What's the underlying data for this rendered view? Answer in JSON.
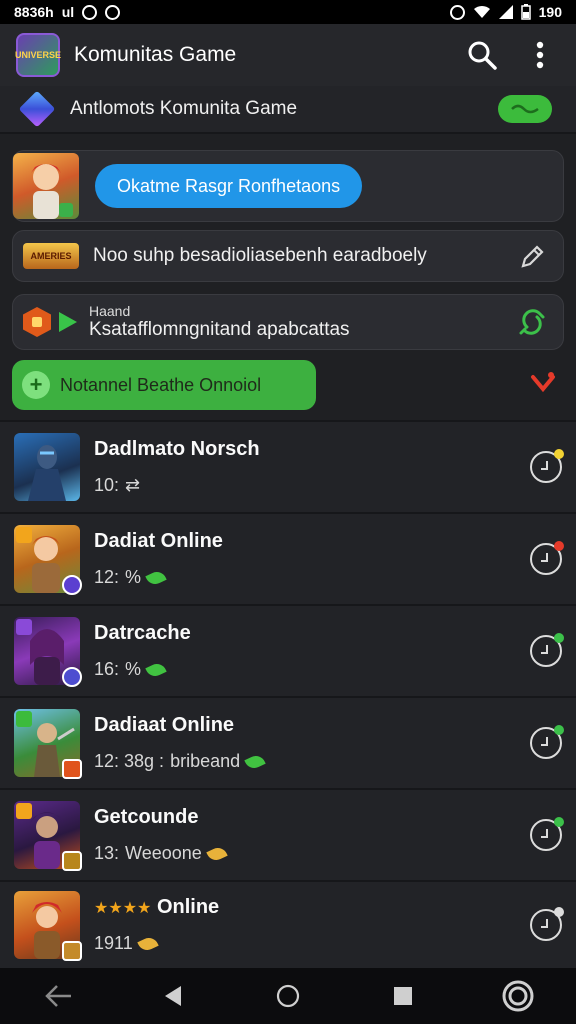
{
  "status_bar": {
    "left_text": "8836h",
    "left_extra": "ul",
    "right_text": "190"
  },
  "app_bar": {
    "title": "Komunitas Game",
    "logo_text": "UNIVERSE"
  },
  "community": {
    "label": "Antlomots Komunita Game",
    "bubble_text": ""
  },
  "cards": {
    "card1": {
      "button_label": "Okatme Rasgr Ronfhetaons"
    },
    "card2": {
      "badge_text": "AMERIES",
      "text": "Noo suhp besadioliasebenh earadboely"
    },
    "card3": {
      "small_text": "Haand",
      "main_text": "Ksatafflomngnitand apabcattas"
    }
  },
  "green_pill": {
    "label": "Notannel Beathe Onnoiol"
  },
  "list_items": [
    {
      "title": "Dadlmato Norsch",
      "time": "10:",
      "extra": "",
      "leaf": ""
    },
    {
      "title": "Dadiat Online",
      "time": "12:",
      "extra": "",
      "leaf": "green"
    },
    {
      "title": "Datrcache",
      "time": "16:",
      "extra": "",
      "leaf": "green"
    },
    {
      "title": "Dadiaat Online",
      "time": "12: 38g :",
      "extra": "bribeand",
      "leaf": "green"
    },
    {
      "title": "Getcounde",
      "time": "13:",
      "extra": "Weeoone",
      "leaf": "gold"
    },
    {
      "title": "Online",
      "time": "1911",
      "extra": "",
      "leaf": "gold"
    }
  ],
  "colors": {
    "accent_blue": "#2196e8",
    "accent_green": "#3db040",
    "background": "#1f2023"
  },
  "icons": [
    "search-icon",
    "more-vert-icon",
    "edit-icon",
    "clock-icon",
    "back-icon",
    "home-icon",
    "recents-icon"
  ]
}
